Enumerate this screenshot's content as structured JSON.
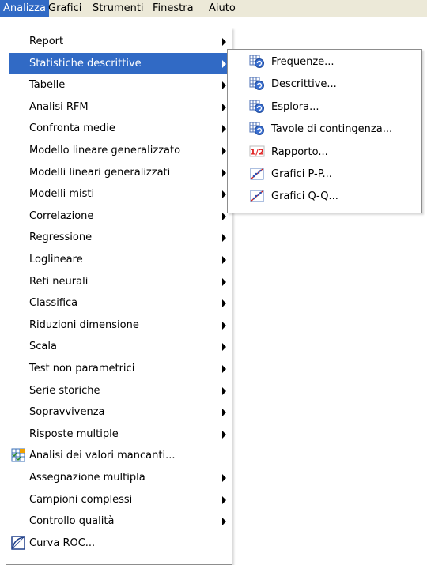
{
  "menubar": {
    "items": [
      "Analizza",
      "Grafici",
      "Strumenti",
      "Finestra",
      "Aiuto"
    ],
    "active": "Analizza"
  },
  "analyze_menu": {
    "items": [
      {
        "label": "Report",
        "submenu": true
      },
      {
        "label": "Statistiche descrittive",
        "submenu": true,
        "highlighted": true
      },
      {
        "label": "Tabelle",
        "submenu": true
      },
      {
        "label": "Analisi RFM",
        "submenu": true
      },
      {
        "label": "Confronta medie",
        "submenu": true
      },
      {
        "label": "Modello lineare generalizzato",
        "submenu": true
      },
      {
        "label": "Modelli lineari generalizzati",
        "submenu": true
      },
      {
        "label": "Modelli misti",
        "submenu": true
      },
      {
        "label": "Correlazione",
        "submenu": true
      },
      {
        "label": "Regressione",
        "submenu": true
      },
      {
        "label": "Loglineare",
        "submenu": true
      },
      {
        "label": "Reti neurali",
        "submenu": true
      },
      {
        "label": "Classifica",
        "submenu": true
      },
      {
        "label": "Riduzioni dimensione",
        "submenu": true
      },
      {
        "label": "Scala",
        "submenu": true
      },
      {
        "label": "Test non parametrici",
        "submenu": true
      },
      {
        "label": "Serie storiche",
        "submenu": true
      },
      {
        "label": "Sopravvivenza",
        "submenu": true
      },
      {
        "label": "Risposte multiple",
        "submenu": true
      },
      {
        "label": "Analisi dei valori mancanti...",
        "submenu": false,
        "icon": "missing-values-icon"
      },
      {
        "label": "Assegnazione multipla",
        "submenu": true
      },
      {
        "label": "Campioni complessi",
        "submenu": true
      },
      {
        "label": "Controllo qualità",
        "submenu": true
      },
      {
        "label": "Curva ROC...",
        "submenu": false,
        "icon": "roc-curve-icon"
      }
    ]
  },
  "descriptive_submenu": {
    "items": [
      {
        "label": "Frequenze...",
        "icon": "frequencies-icon"
      },
      {
        "label": "Descrittive...",
        "icon": "descriptives-icon"
      },
      {
        "label": "Esplora...",
        "icon": "explore-icon"
      },
      {
        "label": "Tavole di contingenza...",
        "icon": "crosstabs-icon"
      },
      {
        "label": "Rapporto...",
        "icon": "ratio-icon",
        "icon_text": "1/2"
      },
      {
        "label": "Grafici P-P...",
        "icon": "pp-plot-icon"
      },
      {
        "label": "Grafici Q-Q...",
        "icon": "qq-plot-icon"
      }
    ]
  },
  "colors": {
    "highlight": "#316ac5",
    "menubar_bg": "#ece9d8",
    "ratio_red": "#e02020"
  }
}
